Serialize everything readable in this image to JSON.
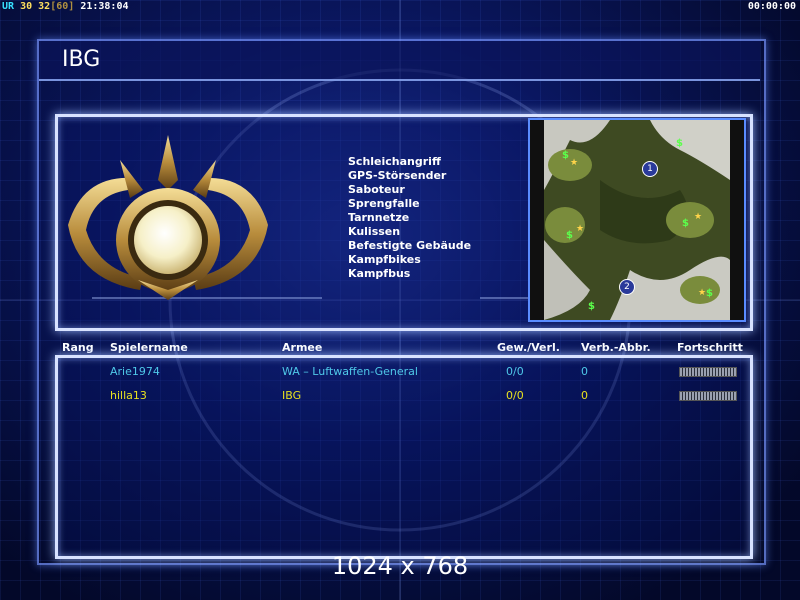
{
  "hud": {
    "tag1": "UR",
    "tag2": "30",
    "tag3": "32",
    "tag4": "[60]",
    "clock": "21:38:04",
    "timer": "00:00:00"
  },
  "title": "IBG",
  "features": [
    "Schleichangriff",
    "GPS-Störsender",
    "Saboteur",
    "Sprengfalle",
    "Tarnnetze",
    "Kulissen",
    "Befestigte Gebäude",
    "Kampfbikes",
    "Kampfbus"
  ],
  "map": {
    "start1": "1",
    "start2": "2",
    "supply": "$"
  },
  "table": {
    "headers": {
      "rank": "Rang",
      "name": "Spielername",
      "army": "Armee",
      "winloss": "Gew./Verl.",
      "disconnects": "Verb.-Abbr.",
      "progress": "Fortschritt"
    },
    "rows": [
      {
        "name": "Arie1974",
        "army": "WA – Luftwaffen-General",
        "winloss": "0/0",
        "disconnects": "0",
        "color": "#4fc8e8"
      },
      {
        "name": "hilla13",
        "army": "IBG",
        "winloss": "0/0",
        "disconnects": "0",
        "color": "#e8e020"
      }
    ]
  },
  "resolution": "1024 x 768",
  "colors": {
    "frame": "#d8e2ff",
    "accent_blue": "#5a8cff"
  }
}
